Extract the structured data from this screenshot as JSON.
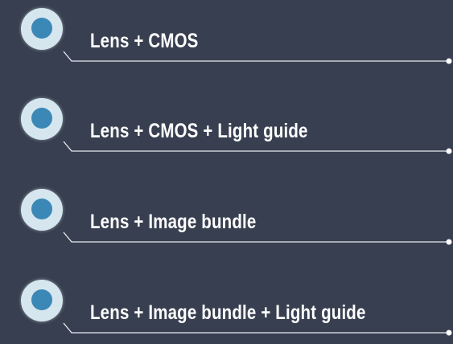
{
  "colors": {
    "background": "#383f50",
    "bullet_ring": "#d6e6ee",
    "bullet_core": "#3b88b7",
    "connector_line": "#e8edf2",
    "label_text": "#ffffff"
  },
  "items": [
    {
      "label": "Lens + CMOS",
      "icon": "circle-bullet-icon"
    },
    {
      "label": "Lens + CMOS + Light guide",
      "icon": "circle-bullet-icon"
    },
    {
      "label": "Lens + Image bundle",
      "icon": "circle-bullet-icon"
    },
    {
      "label": "Lens + Image bundle + Light guide",
      "icon": "circle-bullet-icon"
    }
  ]
}
